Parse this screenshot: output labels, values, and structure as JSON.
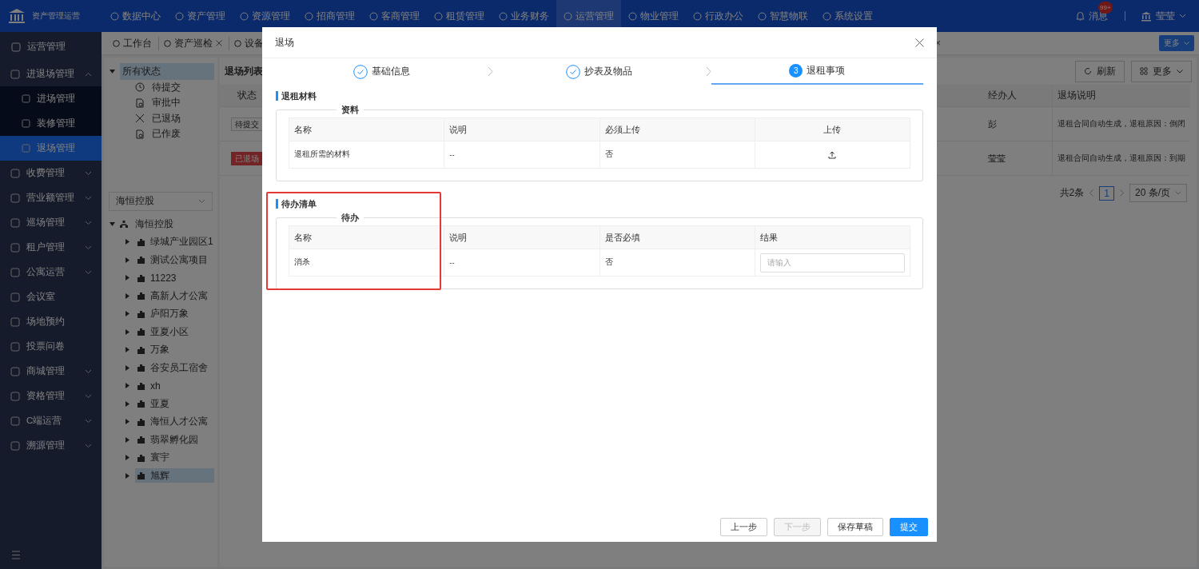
{
  "nav": {
    "logo": "资产管理运营",
    "items": [
      {
        "label": "数据中心",
        "selected": false
      },
      {
        "label": "资产管理",
        "selected": false
      },
      {
        "label": "资源管理",
        "selected": false
      },
      {
        "label": "招商管理",
        "selected": false
      },
      {
        "label": "客商管理",
        "selected": false
      },
      {
        "label": "租赁管理",
        "selected": false
      },
      {
        "label": "业务财务",
        "selected": false
      },
      {
        "label": "运营管理",
        "selected": true
      },
      {
        "label": "物业管理",
        "selected": false
      },
      {
        "label": "行政办公",
        "selected": false
      },
      {
        "label": "智慧物联",
        "selected": false
      },
      {
        "label": "系统设置",
        "selected": false
      }
    ],
    "messages": {
      "label": "消息",
      "badge": "99+"
    },
    "user": "莹莹"
  },
  "sidebar": {
    "header": "运营管理",
    "items": [
      {
        "label": "进退场管理",
        "kind": "group",
        "expanded": true,
        "children": [
          {
            "label": "进场管理",
            "selected": false
          },
          {
            "label": "装修管理",
            "selected": false
          },
          {
            "label": "退场管理",
            "selected": true
          }
        ]
      },
      {
        "label": "收费管理",
        "kind": "group",
        "expanded": false
      },
      {
        "label": "营业额管理",
        "kind": "group",
        "expanded": false
      },
      {
        "label": "巡场管理",
        "kind": "group",
        "expanded": false
      },
      {
        "label": "租户管理",
        "kind": "group",
        "expanded": false
      },
      {
        "label": "公寓运营",
        "kind": "group",
        "expanded": false
      },
      {
        "label": "会议室",
        "kind": "link"
      },
      {
        "label": "场地预约",
        "kind": "link"
      },
      {
        "label": "投票问卷",
        "kind": "link"
      },
      {
        "label": "商城管理",
        "kind": "group",
        "expanded": false
      },
      {
        "label": "资格管理",
        "kind": "group",
        "expanded": false
      },
      {
        "label": "C端运营",
        "kind": "group",
        "expanded": false
      },
      {
        "label": "溯源管理",
        "kind": "group",
        "expanded": false
      }
    ]
  },
  "tabs": [
    {
      "label": "工作台",
      "closable": false
    },
    {
      "label": "资产巡检",
      "closable": true
    },
    {
      "label": "设备",
      "closable": false
    }
  ],
  "hidden_tab_close": "×",
  "tabs_more": "更多",
  "status_tree": {
    "label": "所有状态",
    "selected": true,
    "children": [
      {
        "label": "待提交",
        "kind": "clock",
        "selected": false
      },
      {
        "label": "审批中",
        "kind": "doc",
        "selected": false
      },
      {
        "label": "已退场",
        "kind": "cross",
        "selected": false
      },
      {
        "label": "已作废",
        "kind": "doc",
        "selected": false
      }
    ]
  },
  "org_select": {
    "value": "海恒控股"
  },
  "org_tree": {
    "label": "海恒控股",
    "expanded": true,
    "children": [
      {
        "label": "绿城产业园区1",
        "selected": false
      },
      {
        "label": "测试公寓项目",
        "selected": false
      },
      {
        "label": "11223",
        "selected": false
      },
      {
        "label": "高新人才公寓",
        "selected": false
      },
      {
        "label": "庐阳万象",
        "selected": false
      },
      {
        "label": "亚夏小区",
        "selected": false
      },
      {
        "label": "万象",
        "selected": false
      },
      {
        "label": "谷安员工宿舍",
        "selected": false
      },
      {
        "label": "xh",
        "selected": false
      },
      {
        "label": "亚夏",
        "selected": false
      },
      {
        "label": "海恒人才公寓",
        "selected": false
      },
      {
        "label": "翡翠孵化园",
        "selected": false
      },
      {
        "label": "寰宇",
        "selected": false
      },
      {
        "label": "旭辉",
        "selected": true
      }
    ]
  },
  "list": {
    "title": "退场列表",
    "buttons": [
      "刷新",
      "更多"
    ],
    "columns": [
      "状态",
      "经办人",
      "退场说明"
    ],
    "rows": [
      {
        "status": "待提交",
        "kind": "pending",
        "handler": "彭",
        "note": "退租合同自动生成，退租原因：倒闭"
      },
      {
        "status": "已退场",
        "kind": "exited",
        "handler": "莹莹",
        "note": "退租合同自动生成，退租原因：到期"
      }
    ],
    "pagination": {
      "total": "共2条",
      "page": "1",
      "page_size": "20 条/页"
    }
  },
  "modal": {
    "title": "退场",
    "steps": [
      {
        "label": "基础信息",
        "kind": "done"
      },
      {
        "label": "抄表及物品",
        "kind": "done"
      },
      {
        "label": "退租事项",
        "kind": "active",
        "number": "3"
      }
    ],
    "sections": [
      {
        "title": "退租材料",
        "legend": "资料",
        "highlighted": false,
        "columns": [
          "名称",
          "说明",
          "必须上传",
          "上传"
        ],
        "rows": [
          {
            "cells": [
              "退租所需的材料",
              "--",
              "否"
            ],
            "kind": "upload"
          }
        ]
      },
      {
        "title": "待办清单",
        "legend": "待办",
        "highlighted": true,
        "columns": [
          "名称",
          "说明",
          "是否必填",
          "结果"
        ],
        "rows": [
          {
            "cells": [
              "消杀",
              "--",
              "否"
            ],
            "kind": "input",
            "placeholder": "请输入"
          }
        ]
      }
    ],
    "buttons": [
      {
        "label": "上一步",
        "kind": "default",
        "disabled": false
      },
      {
        "label": "下一步",
        "kind": "default",
        "disabled": true
      },
      {
        "label": "保存草稿",
        "kind": "default",
        "disabled": false
      },
      {
        "label": "提交",
        "kind": "primary",
        "disabled": false
      }
    ]
  }
}
